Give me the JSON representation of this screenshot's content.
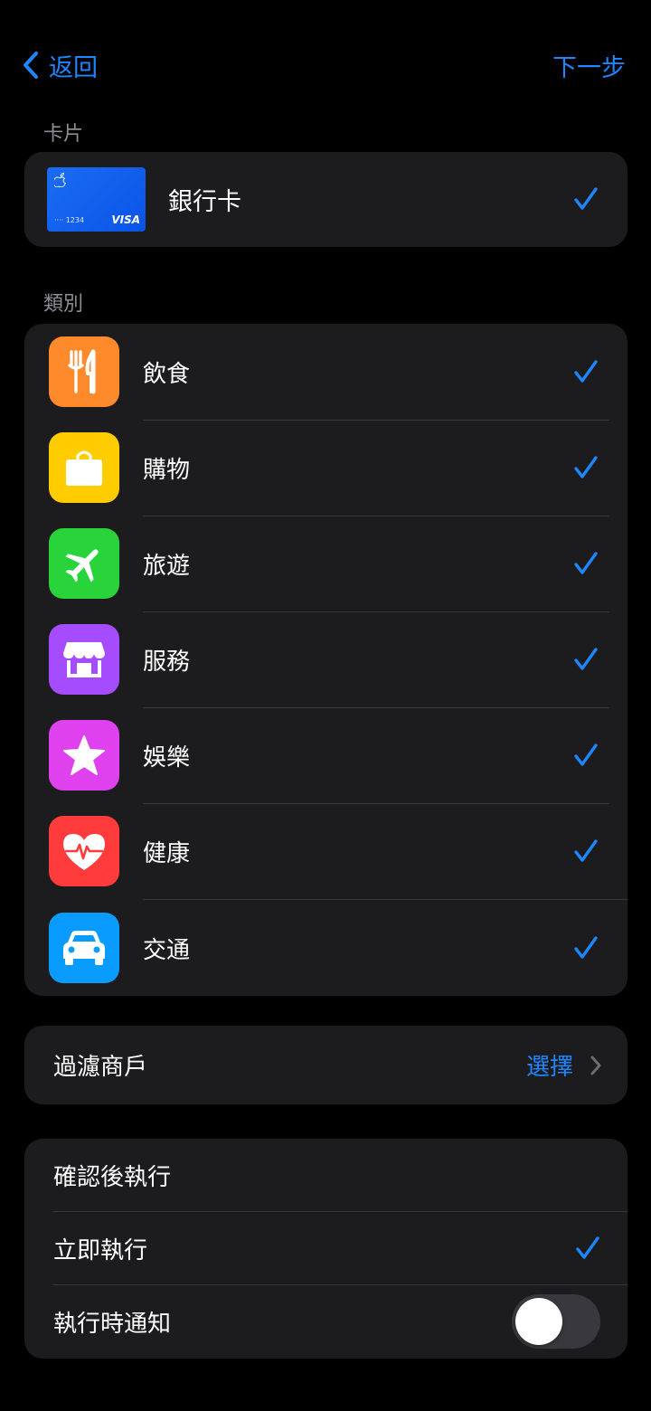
{
  "nav": {
    "back_label": "返回",
    "next_label": "下一步"
  },
  "sections": {
    "card_label": "卡片",
    "category_label": "類別"
  },
  "card": {
    "name": "銀行卡",
    "digits": "···· 1234",
    "network": "VISA",
    "selected": true
  },
  "categories": [
    {
      "label": "飲食",
      "icon": "fork-knife-icon",
      "color": "#ff8a2b",
      "selected": true
    },
    {
      "label": "購物",
      "icon": "shopping-bag-icon",
      "color": "#ffcc00",
      "selected": true
    },
    {
      "label": "旅遊",
      "icon": "airplane-icon",
      "color": "#29d43a",
      "selected": true
    },
    {
      "label": "服務",
      "icon": "storefront-icon",
      "color": "#a54cff",
      "selected": true
    },
    {
      "label": "娛樂",
      "icon": "star-icon",
      "color": "#e041ef",
      "selected": true
    },
    {
      "label": "健康",
      "icon": "heart-pulse-icon",
      "color": "#ff3b3b",
      "selected": true
    },
    {
      "label": "交通",
      "icon": "car-icon",
      "color": "#0a9bff",
      "selected": true
    }
  ],
  "filter": {
    "label": "過濾商戶",
    "action": "選擇"
  },
  "run": {
    "confirm_label": "確認後執行",
    "immediate_label": "立即執行",
    "immediate_selected": true,
    "notify_label": "執行時通知",
    "notify_on": false
  },
  "colors": {
    "accent": "#1e86ff",
    "background": "#000000",
    "group": "#1c1c1e",
    "secondary_text": "#8d8d93"
  }
}
